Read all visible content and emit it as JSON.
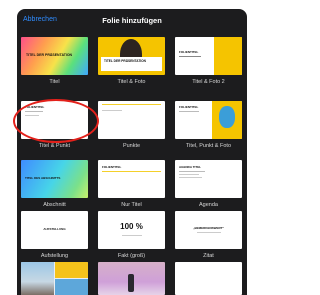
{
  "header": {
    "cancel_label": "Abbrechen",
    "title": "Folie hinzufügen"
  },
  "layouts": [
    {
      "label": "Titel",
      "thumb_text": "TITEL DER PRÄSENTATION"
    },
    {
      "label": "Titel & Foto",
      "thumb_text": "TITEL DER PRÄSENTATION"
    },
    {
      "label": "Titel & Foto 2",
      "thumb_text": "FOLIENTITEL"
    },
    {
      "label": "Titel & Punkt",
      "thumb_text": "FOLIENTITEL"
    },
    {
      "label": "Punkte",
      "thumb_text": ""
    },
    {
      "label": "Titel, Punkt & Foto",
      "thumb_text": "FOLIENTITEL"
    },
    {
      "label": "Abschnitt",
      "thumb_text": "TITEL DES ABSCHNITTS"
    },
    {
      "label": "Nur Titel",
      "thumb_text": "FOLIENTITEL"
    },
    {
      "label": "Agenda",
      "thumb_text": "AGENDA TITEL"
    },
    {
      "label": "Aufstellung",
      "thumb_text": "AUFSTELLUNG"
    },
    {
      "label": "Fakt (groß)",
      "thumb_text": "100 %"
    },
    {
      "label": "Zitat",
      "thumb_text": "„BEMERKENSWERT“"
    }
  ],
  "colors": {
    "accent": "#2f8cff",
    "sheet_bg": "#1c1c1e",
    "highlight": "#e3211b",
    "bar": "#f4d02a"
  }
}
